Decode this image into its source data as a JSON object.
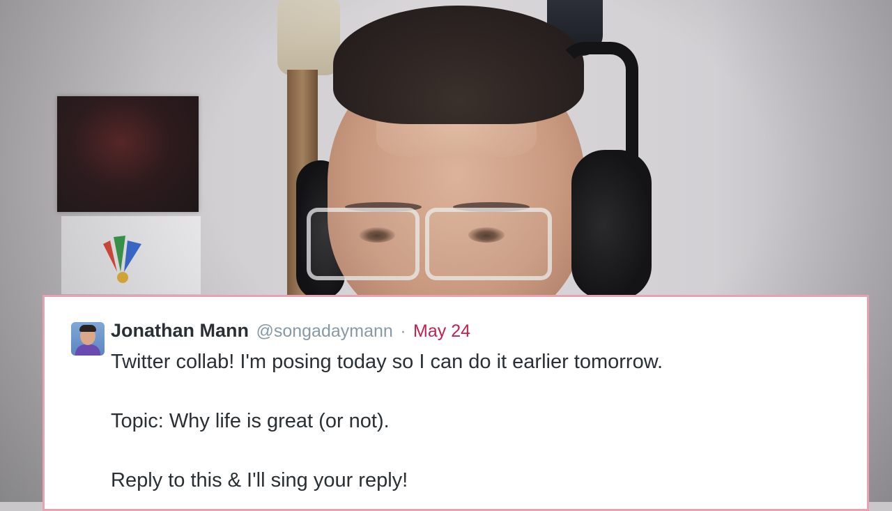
{
  "tweet": {
    "author_name": "Jonathan Mann",
    "handle": "@songadaymann",
    "separator": "·",
    "date": "May 24",
    "lines": [
      "Twitter collab! I'm posing today so I can do it earlier tomorrow.",
      "Topic: Why life is great (or not).",
      "Reply to this & I'll sing your reply!"
    ],
    "colors": {
      "card_border": "#e6a3b4",
      "date": "#c4214f",
      "handle": "#8899a6",
      "text": "#292f33"
    }
  }
}
